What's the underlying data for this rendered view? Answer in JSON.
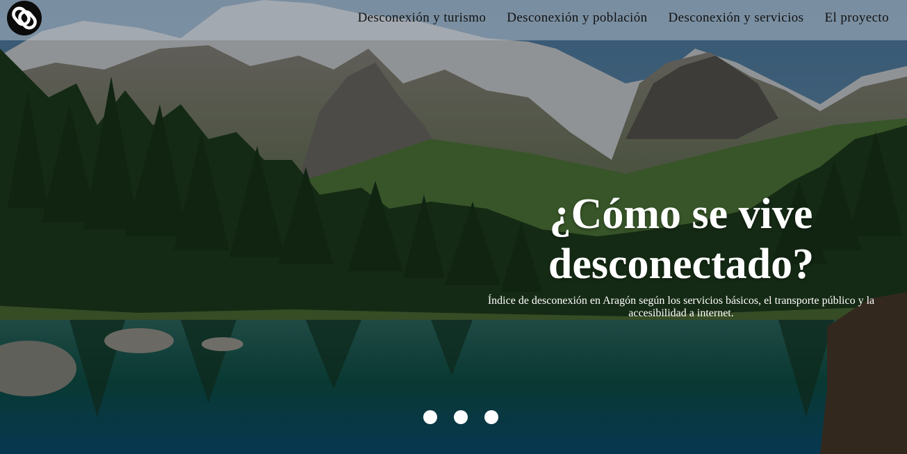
{
  "nav": {
    "logo_icon": "chain-link-icon",
    "items": [
      {
        "label": "Desconexión y turismo"
      },
      {
        "label": "Desconexión y población"
      },
      {
        "label": "Desconexión y servicios"
      },
      {
        "label": "El proyecto"
      }
    ]
  },
  "hero": {
    "title_line1": "¿Cómo se vive",
    "title_line2": "desconectado?",
    "subtitle": "Índice de desconexión en Aragón según los servicios básicos, el transporte público y la accesibilidad a internet."
  },
  "carousel": {
    "slide_count": 3
  },
  "colors": {
    "navbar_bg": "#b2bcc6",
    "text_dark": "#111111",
    "text_light": "#ffffff",
    "logo_bg": "#0b0b0b"
  }
}
